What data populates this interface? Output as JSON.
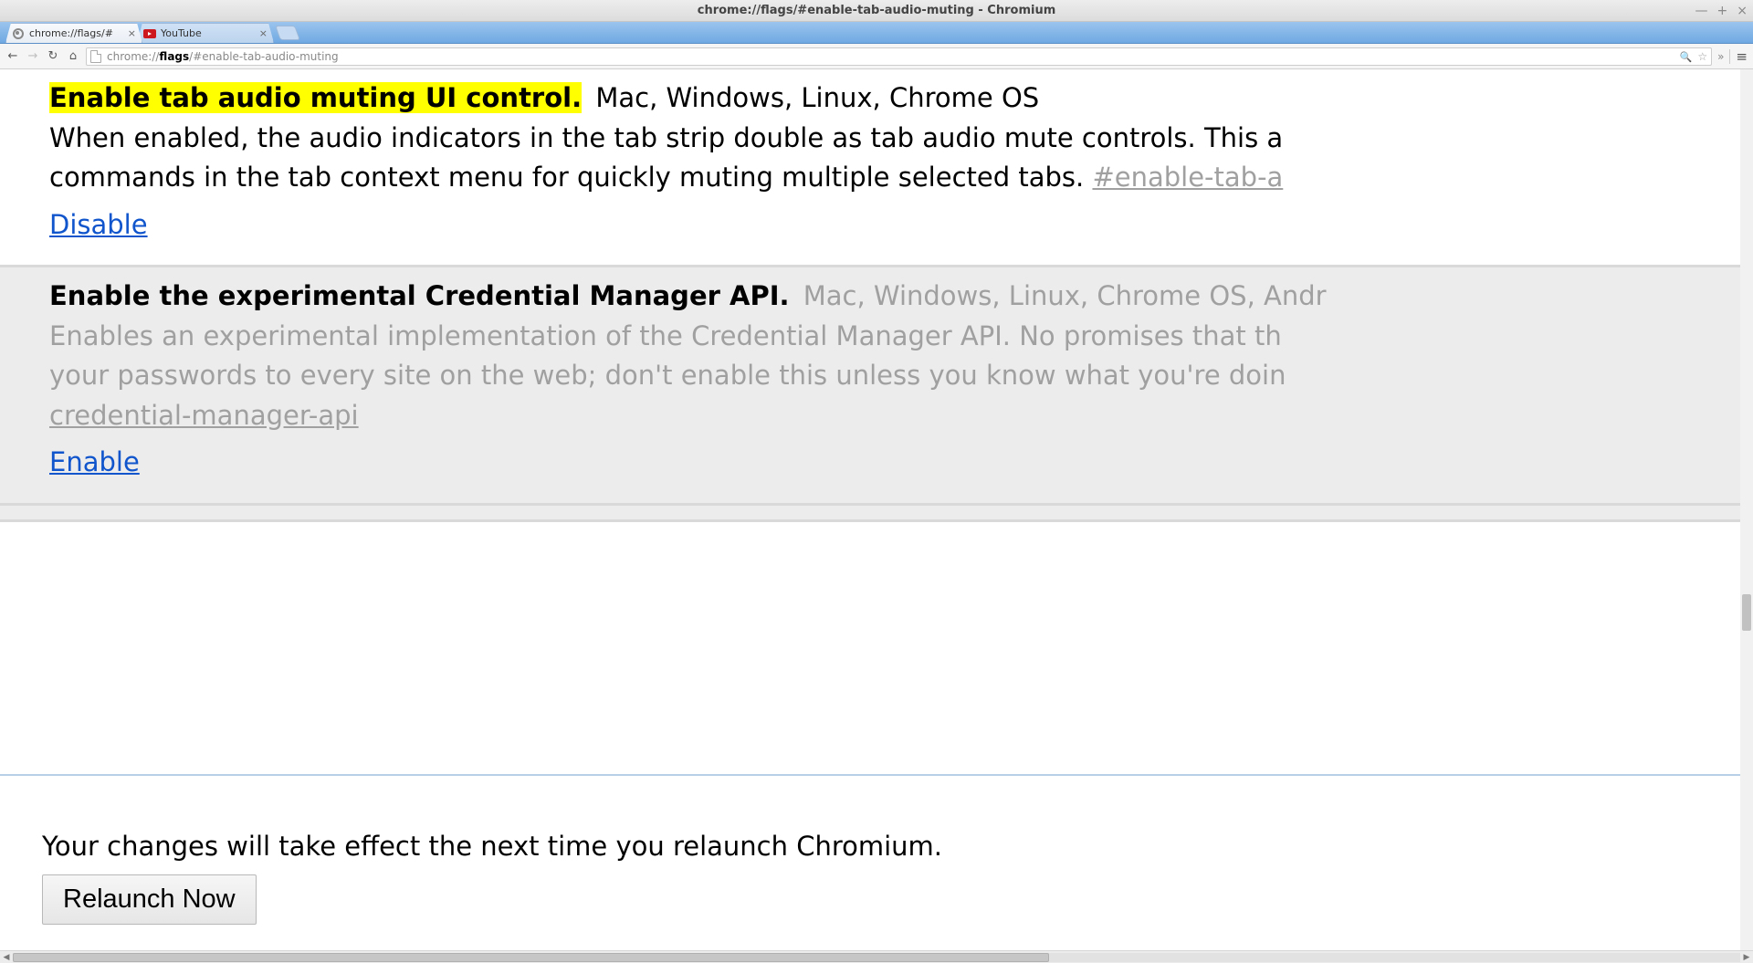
{
  "os": {
    "window_title": "chrome://flags/#enable-tab-audio-muting - Chromium",
    "btn_min": "—",
    "btn_max": "+",
    "btn_close": "×"
  },
  "tabs": [
    {
      "title": "chrome://flags/#",
      "kind": "chromium"
    },
    {
      "title": "YouTube",
      "kind": "youtube"
    }
  ],
  "omnibox": {
    "protocol": "chrome://",
    "host": "flags",
    "path": "/#enable-tab-audio-muting"
  },
  "flags": [
    {
      "id": "enable-tab-audio-muting",
      "title": "Enable tab audio muting UI control.",
      "highlighted": true,
      "platforms": "Mac, Windows, Linux, Chrome OS",
      "desc_line1": "When enabled, the audio indicators in the tab strip double as tab audio mute controls. This a",
      "desc_line2_prefix": "commands in the tab context menu for quickly muting multiple selected tabs. ",
      "anchor": "#enable-tab-a",
      "action": "Disable",
      "enabled": true
    },
    {
      "id": "enable-credential-manager-api",
      "title": "Enable the experimental Credential Manager API.",
      "highlighted": false,
      "platforms": "Mac, Windows, Linux, Chrome OS, Andr",
      "desc_line1": "Enables an experimental implementation of the Credential Manager API. No promises that th",
      "desc_line2_prefix": "your passwords to every site on the web; don't enable this unless you know what you're doin",
      "anchor": "credential-manager-api",
      "action": "Enable",
      "enabled": false
    }
  ],
  "relaunch": {
    "message": "Your changes will take effect the next time you relaunch Chromium.",
    "button": "Relaunch Now"
  }
}
